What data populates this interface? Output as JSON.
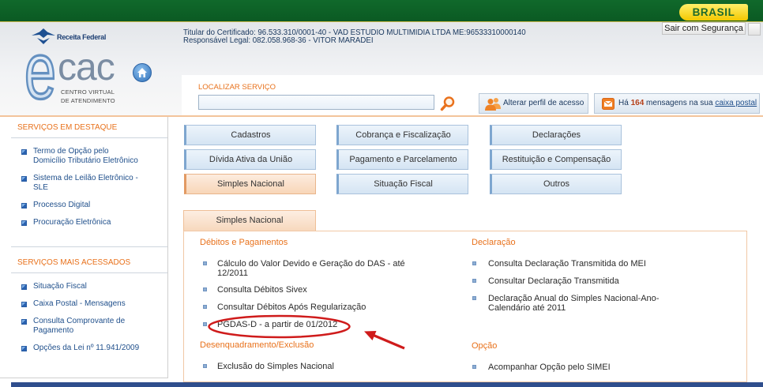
{
  "gov_bar": {
    "brand_label": "BRASIL"
  },
  "session": {
    "logout_label": "Sair com Segurança"
  },
  "header": {
    "org_name": "Receita Federal",
    "logo_mark": "e",
    "logo_wordmark": "cac",
    "logo_subtitle_1": "CENTRO VIRTUAL",
    "logo_subtitle_2": "DE ATENDIMENTO",
    "certificate_holder": "Titular do Certificado: 96.533.310/0001-40 - VAD ESTUDIO MULTIMIDIA LTDA ME:96533310000140",
    "legal_responsible": "Responsável Legal: 082.058.968-36 - VITOR MARADEI"
  },
  "search": {
    "label": "LOCALIZAR SERVIÇO",
    "value": "",
    "placeholder": ""
  },
  "toolbar": {
    "profile_label": "Alterar perfil de acesso",
    "mail_prefix": "Há",
    "mail_count": "164",
    "mail_text": "mensagens na sua",
    "mail_link": "caixa postal"
  },
  "sidebar": {
    "sections": [
      {
        "title": "SERVIÇOS EM DESTAQUE",
        "items": [
          {
            "label": "Termo de Opção pelo\nDomicílio Tributário Eletrônico"
          },
          {
            "label": "Sistema de Leilão Eletrônico -\nSLE"
          },
          {
            "label": "Processo Digital"
          },
          {
            "label": "Procuração Eletrônica"
          }
        ]
      },
      {
        "title": "SERVIÇOS MAIS ACESSADOS",
        "items": [
          {
            "label": "Situação Fiscal"
          },
          {
            "label": "Caixa Postal - Mensagens"
          },
          {
            "label": "Consulta Comprovante de\nPagamento"
          },
          {
            "label": "Opções da Lei nº 11.941/2009"
          }
        ]
      }
    ]
  },
  "menu": {
    "buttons": [
      {
        "label": "Cadastros"
      },
      {
        "label": "Cobrança e Fiscalização"
      },
      {
        "label": "Declarações"
      },
      {
        "label": "Dívida Ativa da União"
      },
      {
        "label": "Pagamento e Parcelamento"
      },
      {
        "label": "Restituição e Compensação"
      },
      {
        "label": "Simples Nacional",
        "active": true
      },
      {
        "label": "Situação Fiscal"
      },
      {
        "label": "Outros"
      }
    ]
  },
  "panel": {
    "tab_label": "Simples Nacional",
    "groups": [
      {
        "title": "Débitos e Pagamentos",
        "items": [
          {
            "label": "Cálculo do Valor Devido e Geração do DAS - até\n12/2011"
          },
          {
            "label": "Consulta Débitos Sivex"
          },
          {
            "label": "Consultar Débitos Após Regularização"
          },
          {
            "label": "PGDAS-D - a partir de 01/2012",
            "highlighted": true
          }
        ]
      },
      {
        "title": "Desenquadramento/Exclusão",
        "items": [
          {
            "label": "Exclusão do Simples Nacional"
          }
        ]
      },
      {
        "title": "Declaração",
        "items": [
          {
            "label": "Consulta Declaração Transmitida do MEI"
          },
          {
            "label": "Consultar Declaração Transmitida"
          },
          {
            "label": "Declaração Anual do Simples Nacional-Ano-\nCalendário até 2011"
          }
        ]
      },
      {
        "title": "Opção",
        "items": [
          {
            "label": "Acompanhar Opção pelo SIMEI"
          }
        ]
      }
    ]
  },
  "icons": [
    "receita-federal-emblem",
    "ecac-logo",
    "home-icon",
    "exit-icon",
    "search-icon",
    "profile-icon",
    "envelope-icon",
    "bullet-icon"
  ],
  "colors": {
    "green": "#0b5a23",
    "orange": "#e8711b",
    "link": "#1f4f8b",
    "red": "#cf1b1b",
    "menu": "#d5e4f3",
    "menu_active": "#f8d6b8"
  }
}
